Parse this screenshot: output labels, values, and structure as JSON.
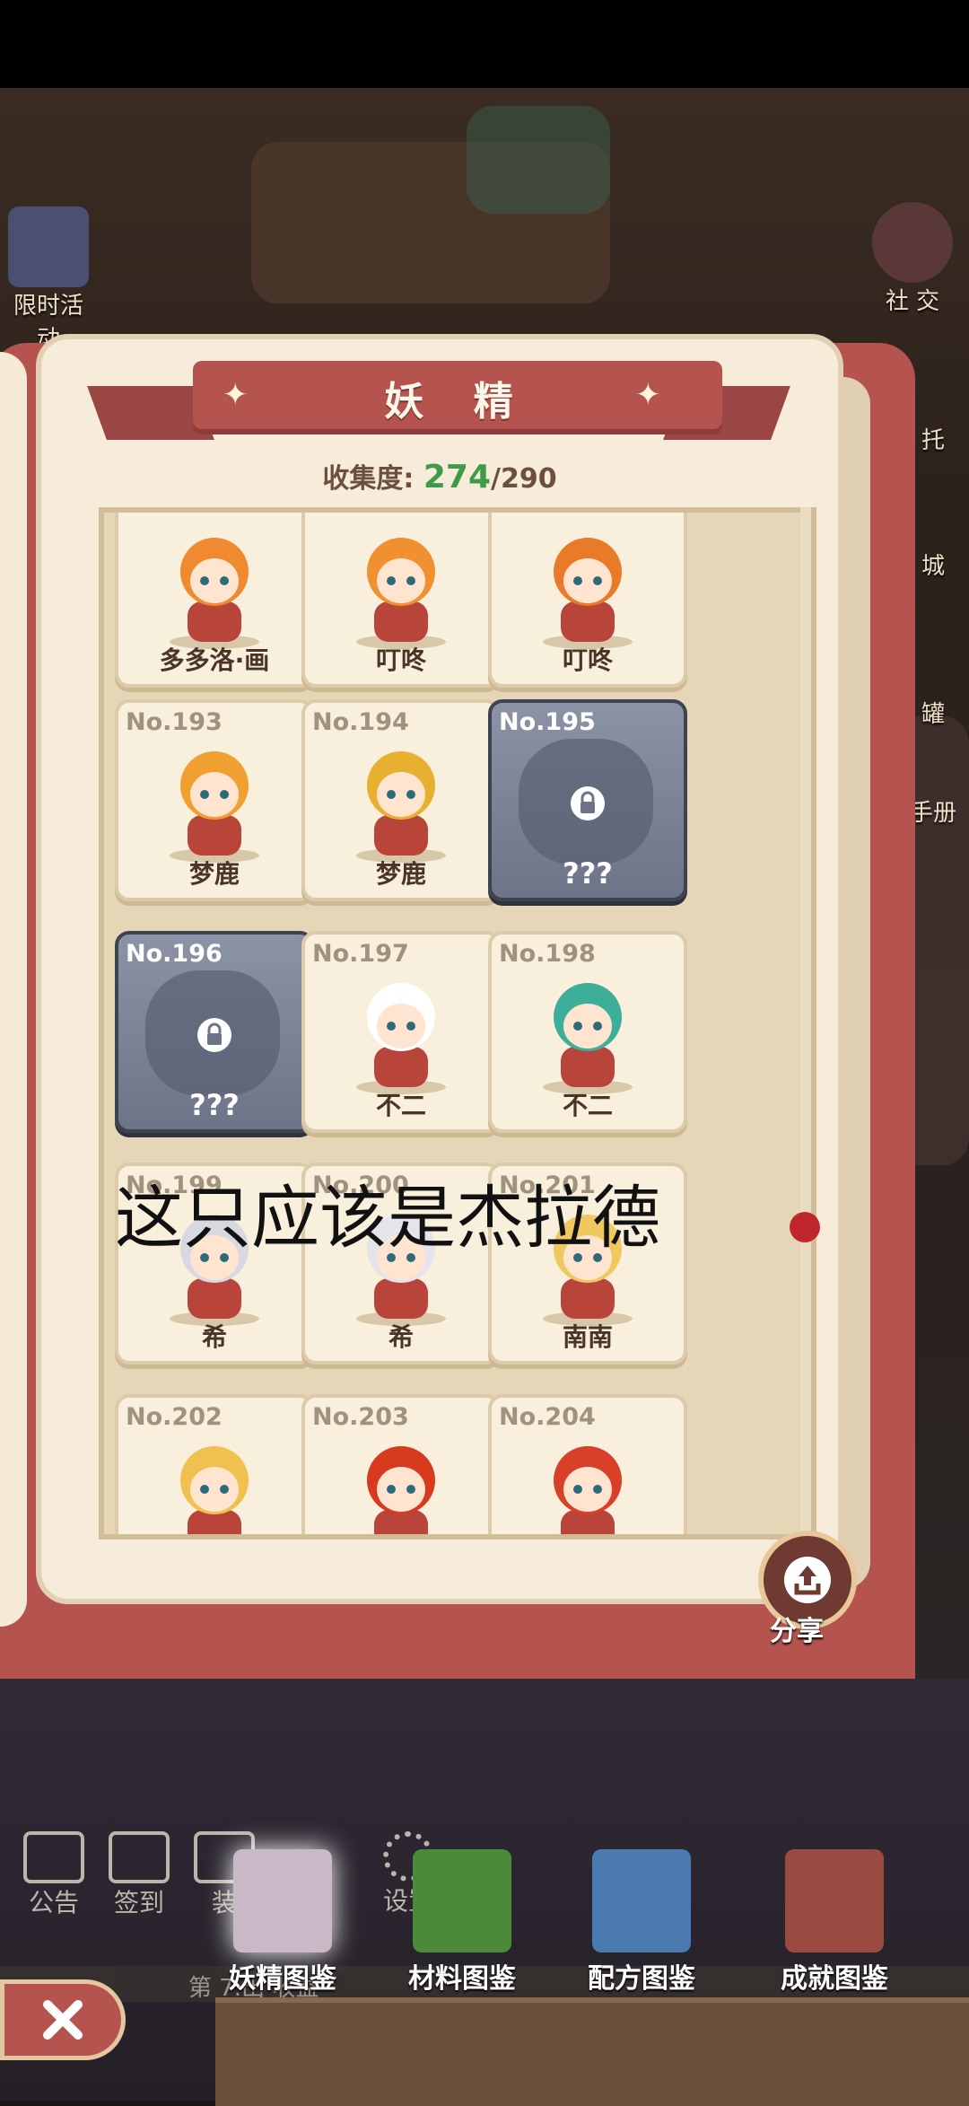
{
  "side_left": {
    "event_label": "限时活动"
  },
  "side_right": {
    "social_label": "社 交",
    "items": [
      "托",
      "城",
      "罐",
      "手册"
    ]
  },
  "book": {
    "title": "妖 精",
    "progress": {
      "label": "收集度:",
      "current": "274",
      "total": "/290"
    }
  },
  "cards": [
    {
      "num": "",
      "name": "多多洛·画",
      "locked": false,
      "hair": "#f08a30"
    },
    {
      "num": "",
      "name": "叮咚",
      "locked": false,
      "hair": "#f09030"
    },
    {
      "num": "",
      "name": "叮咚",
      "locked": false,
      "hair": "#e87a28"
    },
    {
      "num": "No.193",
      "name": "梦鹿",
      "locked": false,
      "hair": "#f0a030"
    },
    {
      "num": "No.194",
      "name": "梦鹿",
      "locked": false,
      "hair": "#e8b030"
    },
    {
      "num": "No.195",
      "name": "???",
      "locked": true,
      "hair": ""
    },
    {
      "num": "No.196",
      "name": "???",
      "locked": true,
      "hair": ""
    },
    {
      "num": "No.197",
      "name": "不二",
      "locked": false,
      "hair": "#ffffff"
    },
    {
      "num": "No.198",
      "name": "不二",
      "locked": false,
      "hair": "#3cae9a"
    },
    {
      "num": "No.199",
      "name": "希",
      "locked": false,
      "hair": "#d8d8e0"
    },
    {
      "num": "No.200",
      "name": "希",
      "locked": false,
      "hair": "#e4e4ea"
    },
    {
      "num": "No.201",
      "name": "南南",
      "locked": false,
      "hair": "#f0c860"
    },
    {
      "num": "No.202",
      "name": "",
      "locked": false,
      "hair": "#f0c050"
    },
    {
      "num": "No.203",
      "name": "",
      "locked": false,
      "hair": "#d83a20"
    },
    {
      "num": "No.204",
      "name": "",
      "locked": false,
      "hair": "#d84028"
    }
  ],
  "overlay": {
    "caption": "这只应该是杰拉德"
  },
  "share": {
    "label": "分享"
  },
  "bottom_icons": [
    "公告",
    "签到",
    "装",
    "设置"
  ],
  "status_strip": {
    "text": "第 7.出 收益"
  },
  "tabs": [
    {
      "label": "妖精图鉴",
      "color": "#c9b8c6",
      "active": true
    },
    {
      "label": "材料图鉴",
      "color": "#4a8a3a",
      "active": false
    },
    {
      "label": "配方图鉴",
      "color": "#4a7ab0",
      "active": false
    },
    {
      "label": "成就图鉴",
      "color": "#9a4a40",
      "active": false
    }
  ],
  "colors": {
    "accent": "#b5544e",
    "progress": "#3f9a4a"
  }
}
